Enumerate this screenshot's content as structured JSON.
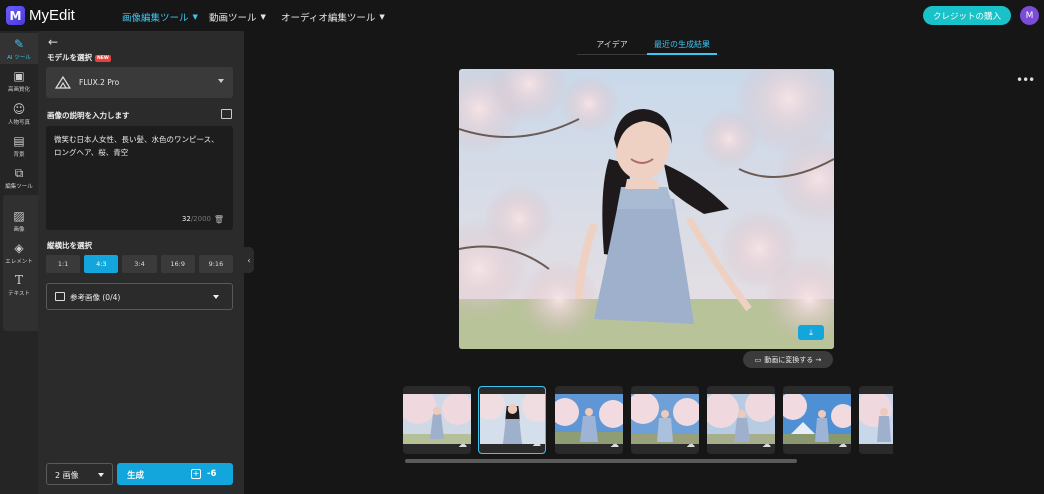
{
  "app": {
    "brand": "MyEdit",
    "logo_letter": "M"
  },
  "nav": [
    {
      "label": "画像編集ツール",
      "active": true
    },
    {
      "label": "動画ツール",
      "active": false
    },
    {
      "label": "オーディオ編集ツール",
      "active": false
    }
  ],
  "header": {
    "buy_button": "クレジットの購入",
    "avatar_letter": "M"
  },
  "rail": [
    {
      "label": "AI ツール",
      "icon": "magic-wand-icon"
    },
    {
      "label": "高画質化",
      "icon": "enhance-icon"
    },
    {
      "label": "人物写真",
      "icon": "portrait-icon"
    },
    {
      "label": "背景",
      "icon": "background-icon"
    },
    {
      "label": "編集ツール",
      "icon": "edit-tools-icon"
    },
    {
      "label": "画像",
      "icon": "image-icon"
    },
    {
      "label": "エレメント",
      "icon": "elements-icon"
    },
    {
      "label": "テキスト",
      "icon": "text-icon"
    }
  ],
  "panel": {
    "model_label": "モデルを選択",
    "new_badge": "NEW",
    "model_name": "FLUX.2 Pro",
    "prompt_label": "画像の説明を入力します",
    "prompt_text": "微笑む日本人女性、長い髪、水色のワンピース、ロングヘア、桜、青空",
    "char_count": "32",
    "char_max": "/2000",
    "ratio_label": "縦横比を選択",
    "ratios": [
      "1:1",
      "4:3",
      "3:4",
      "16:9",
      "9:16"
    ],
    "selected_ratio": "4:3",
    "reference_label": "参考画像 (0/4)",
    "count_value": "2 画像",
    "generate_label": "生成",
    "credit_cost": "-6"
  },
  "main": {
    "tabs": [
      "アイデア",
      "最近の生成結果"
    ],
    "active_tab": 1,
    "video_button": "動画に変換する →",
    "thumbnail_count": 7,
    "selected_thumbnail": 1
  },
  "colors": {
    "accent": "#12a6dc",
    "buy": "#19c2c9",
    "avatar": "#7a4cd8"
  }
}
